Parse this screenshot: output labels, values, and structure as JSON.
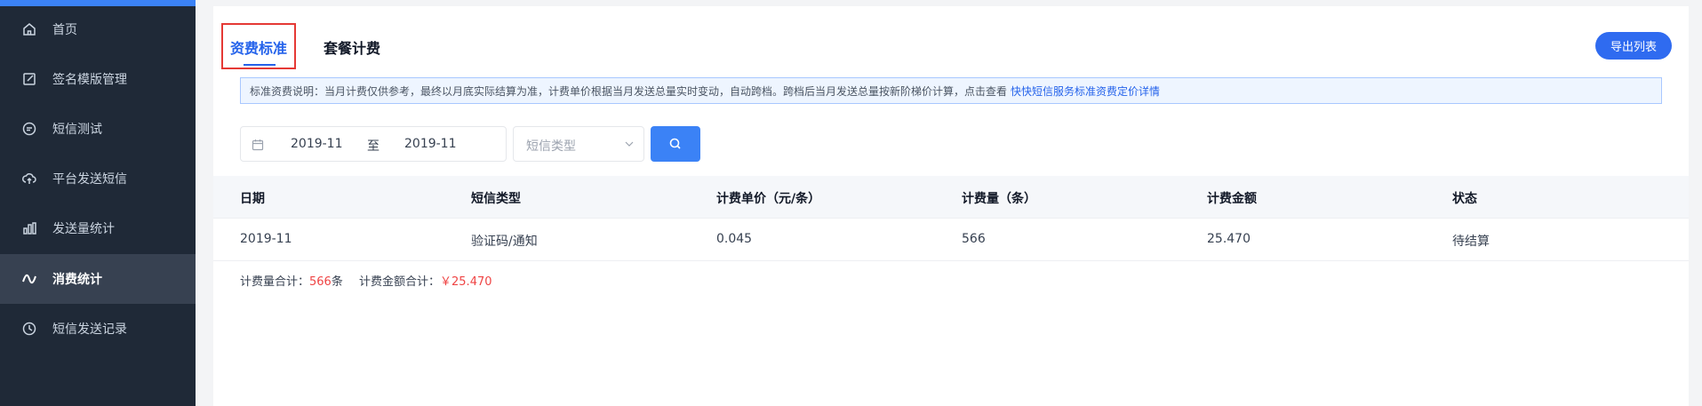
{
  "sidebar": {
    "items": [
      {
        "label": "首页",
        "icon": "home-icon"
      },
      {
        "label": "签名模版管理",
        "icon": "edit-icon"
      },
      {
        "label": "短信测试",
        "icon": "message-icon"
      },
      {
        "label": "平台发送短信",
        "icon": "cloud-upload-icon"
      },
      {
        "label": "发送量统计",
        "icon": "bar-chart-icon"
      },
      {
        "label": "消费统计",
        "icon": "wave-icon",
        "active": true
      },
      {
        "label": "短信发送记录",
        "icon": "clock-icon"
      }
    ]
  },
  "tabs": [
    {
      "label": "资费标准",
      "active": true
    },
    {
      "label": "套餐计费",
      "active": false
    }
  ],
  "export_label": "导出列表",
  "notice": {
    "text": "标准资费说明：当月计费仅供参考，最终以月底实际结算为准，计费单价根据当月发送总量实时变动，自动跨档。跨档后当月发送总量按新阶梯价计算，点击查看",
    "link": "快快短信服务标准资费定价详情"
  },
  "filters": {
    "date_start": "2019-11",
    "date_separator": "至",
    "date_end": "2019-11",
    "type_placeholder": "短信类型"
  },
  "table": {
    "columns": [
      "日期",
      "短信类型",
      "计费单价（元/条）",
      "计费量（条）",
      "计费金额",
      "状态"
    ],
    "rows": [
      [
        "2019-11",
        "验证码/通知",
        "0.045",
        "566",
        "25.470",
        "待结算"
      ]
    ]
  },
  "summary": {
    "count_label": "计费量合计：",
    "count_value": "566",
    "count_unit": "条",
    "amount_label": "计费金额合计：",
    "amount_value": "￥25.470"
  },
  "colors": {
    "sidebar_bg": "#1f2937",
    "accent": "#2563eb",
    "highlight_border": "#e53935",
    "summary_red": "#ef4444"
  }
}
